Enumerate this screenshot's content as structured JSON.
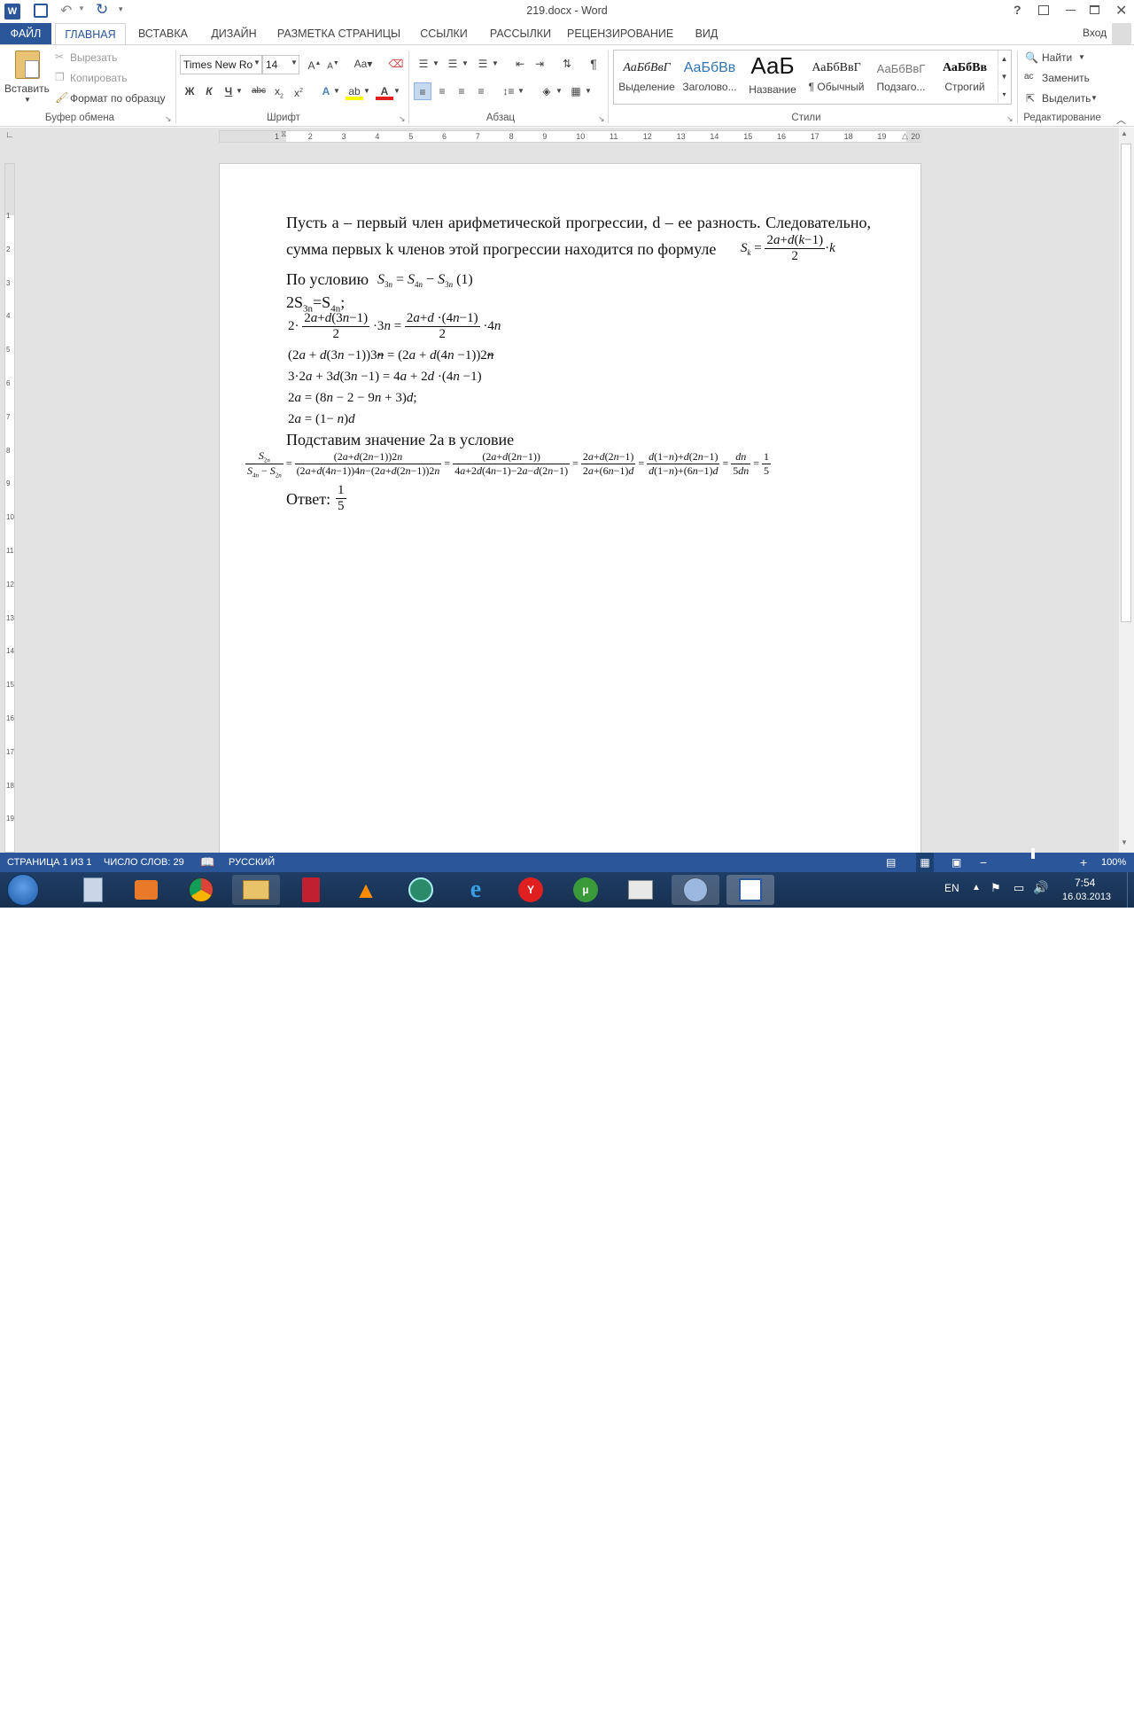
{
  "window": {
    "title": "219.docx - Word",
    "help": "?",
    "user": "Вход"
  },
  "tabs": [
    {
      "label": "ФАЙЛ"
    },
    {
      "label": "ГЛАВНАЯ"
    },
    {
      "label": "ВСТАВКА"
    },
    {
      "label": "ДИЗАЙН"
    },
    {
      "label": "РАЗМЕТКА СТРАНИЦЫ"
    },
    {
      "label": "ССЫЛКИ"
    },
    {
      "label": "РАССЫЛКИ"
    },
    {
      "label": "РЕЦЕНЗИРОВАНИЕ"
    },
    {
      "label": "ВИД"
    }
  ],
  "ribbon": {
    "clipboard": {
      "paste": "Вставить",
      "cut": "Вырезать",
      "copy": "Копировать",
      "format_painter": "Формат по образцу",
      "group": "Буфер обмена"
    },
    "font": {
      "name": "Times New Ro",
      "size": "14",
      "group": "Шрифт"
    },
    "paragraph": {
      "group": "Абзац"
    },
    "styles": {
      "items": [
        {
          "preview": "АаБбВвГ",
          "label": "Выделение"
        },
        {
          "preview": "АаБбВв",
          "label": "Заголово..."
        },
        {
          "preview": "АаБ",
          "label": "Название"
        },
        {
          "preview": "АаБбВвГ",
          "label": "¶ Обычный"
        },
        {
          "preview": "АаБбВвГ",
          "label": "Подзаго..."
        },
        {
          "preview": "АаБбВв",
          "label": "Строгий"
        }
      ],
      "group": "Стили"
    },
    "editing": {
      "find": "Найти",
      "replace": "Заменить",
      "select": "Выделить",
      "group": "Редактирование"
    }
  },
  "ruler": {
    "numbers": [
      "1",
      "2",
      "3",
      "4",
      "5",
      "6",
      "7",
      "8",
      "9",
      "10",
      "11",
      "12",
      "13",
      "14",
      "15",
      "16",
      "17",
      "18",
      "19",
      "20"
    ]
  },
  "vruler": {
    "numbers": [
      "1",
      "2",
      "3",
      "4",
      "5",
      "6",
      "7",
      "8",
      "9",
      "10",
      "11",
      "12",
      "13",
      "14",
      "15",
      "16",
      "17",
      "18",
      "19"
    ]
  },
  "document": {
    "p1_line1": "Пусть a – первый член арифметической прогрессии, d – ее разность. Следовательно,",
    "p1_line2": "сумма первых k членов этой прогрессии находится по формуле",
    "p2": "По условию",
    "p3": "2S",
    "p9": "Подставим значение 2a в условие",
    "answer": "Ответ:"
  },
  "status": {
    "page": "СТРАНИЦА 1 ИЗ 1",
    "words": "ЧИСЛО СЛОВ: 29",
    "language": "РУССКИЙ",
    "zoom": "100%"
  },
  "tray": {
    "lang": "EN",
    "time": "7:54",
    "date": "16.03.2013"
  }
}
